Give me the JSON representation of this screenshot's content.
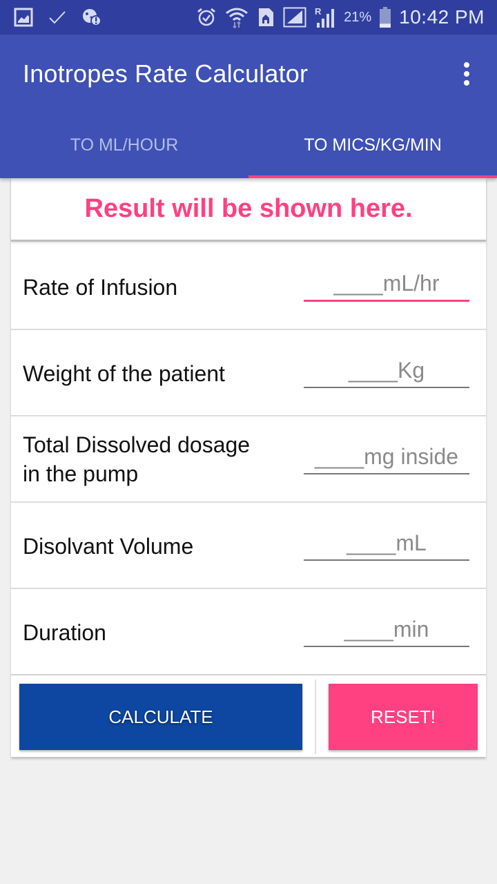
{
  "status_bar": {
    "left_icons": [
      "gallery-notification-icon",
      "check-icon",
      "cookie-alert-icon"
    ],
    "right_icons": [
      "alarm-icon",
      "wifi-icon",
      "home-sim-icon",
      "signal-icon",
      "roaming-signal-icon"
    ],
    "roaming_label": "R",
    "battery_percent": "21%",
    "battery_level": 0.21,
    "time": "10:42 PM"
  },
  "app_bar": {
    "title": "Inotropes Rate Calculator",
    "menu_icon": "overflow-menu-icon"
  },
  "tabs": [
    {
      "label": "TO ML/HOUR",
      "active": false
    },
    {
      "label": "TO MICS/KG/MIN",
      "active": true
    }
  ],
  "colors": {
    "primary": "#3f51b5",
    "primary_dark": "#303f9f",
    "accent": "#ff4081",
    "calculate_button": "#0d47a1"
  },
  "result": {
    "text": "Result will be shown here."
  },
  "form": {
    "fields": [
      {
        "label": "Rate of Infusion",
        "placeholder": "____mL/hr",
        "value": "",
        "focused": true
      },
      {
        "label": "Weight of the patient",
        "placeholder": "____Kg",
        "value": "",
        "focused": false
      },
      {
        "label": "Total Dissolved dosage in the pump",
        "label_line1": "Total Dissolved dosage",
        "label_line2": "in the pump",
        "placeholder": "____mg inside",
        "value": "",
        "focused": false
      },
      {
        "label": "Disolvant Volume",
        "placeholder": "____mL",
        "value": "",
        "focused": false
      },
      {
        "label": "Duration",
        "placeholder": "____min",
        "value": "",
        "focused": false
      }
    ]
  },
  "buttons": {
    "calculate_label": "CALCULATE",
    "reset_label": "RESET!"
  }
}
